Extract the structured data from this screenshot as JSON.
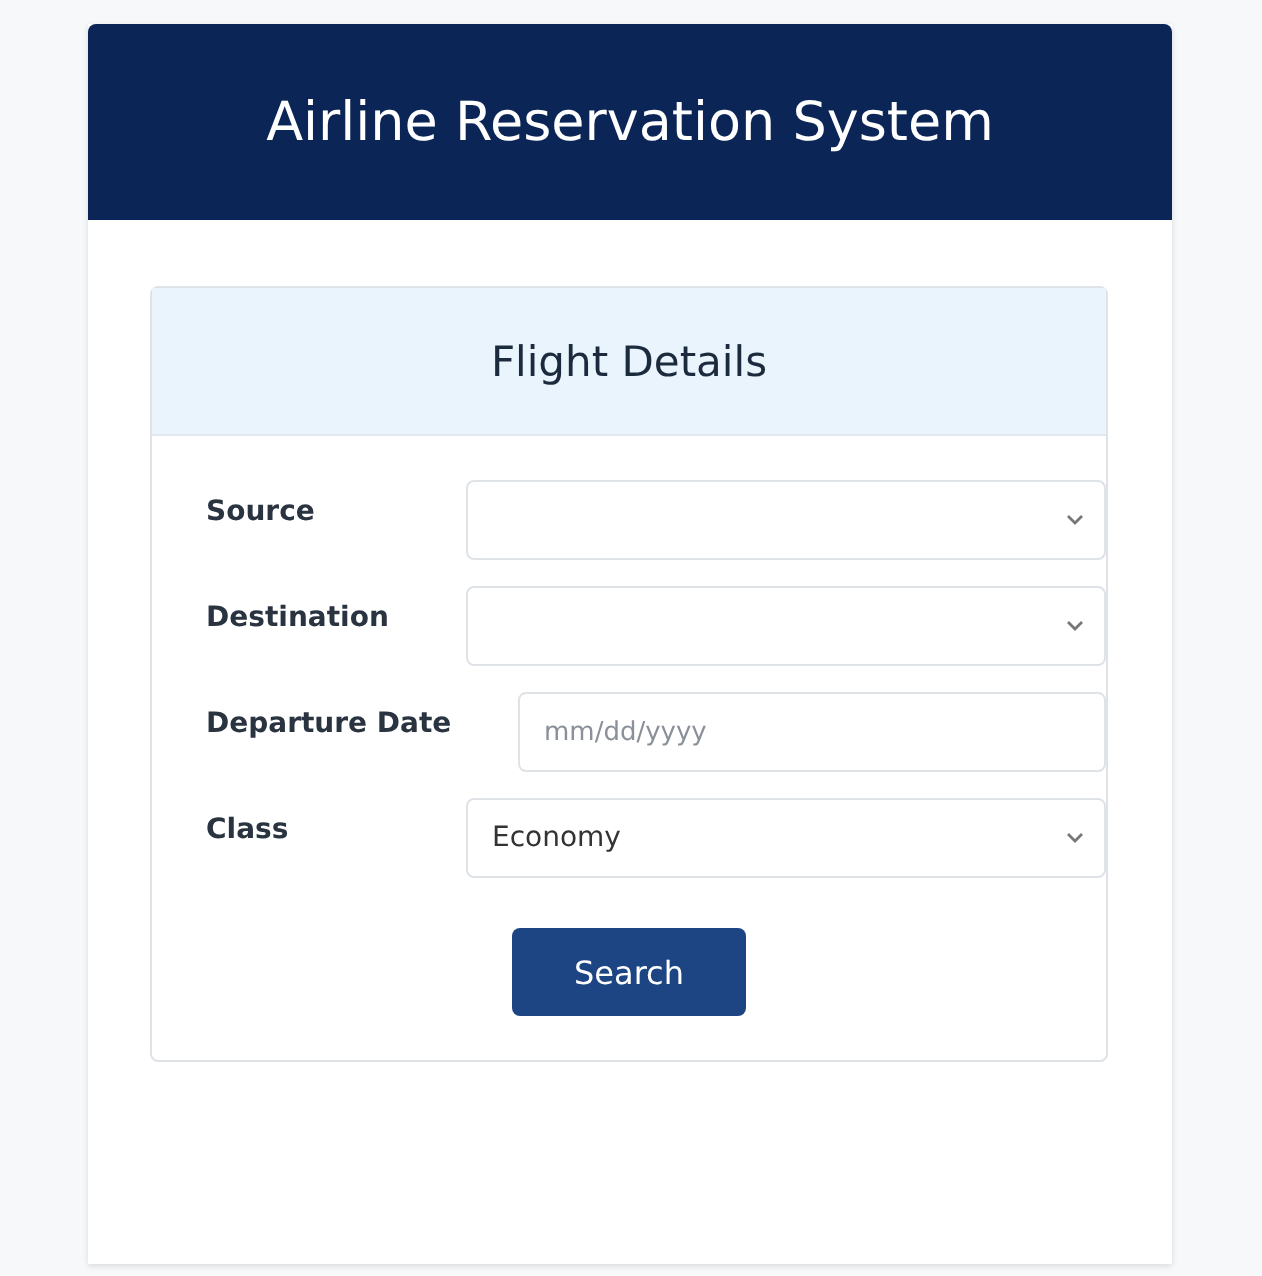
{
  "header": {
    "title": "Airline Reservation System"
  },
  "card": {
    "title": "Flight Details",
    "fields": [
      {
        "label": "Source",
        "kind": "select"
      },
      {
        "label": "Destination",
        "kind": "select"
      },
      {
        "label": "Departure Date",
        "kind": "date",
        "placeholder": "mm/dd/yyyy"
      },
      {
        "label": "Class",
        "kind": "select",
        "value": "Economy"
      }
    ],
    "button": "Search"
  }
}
